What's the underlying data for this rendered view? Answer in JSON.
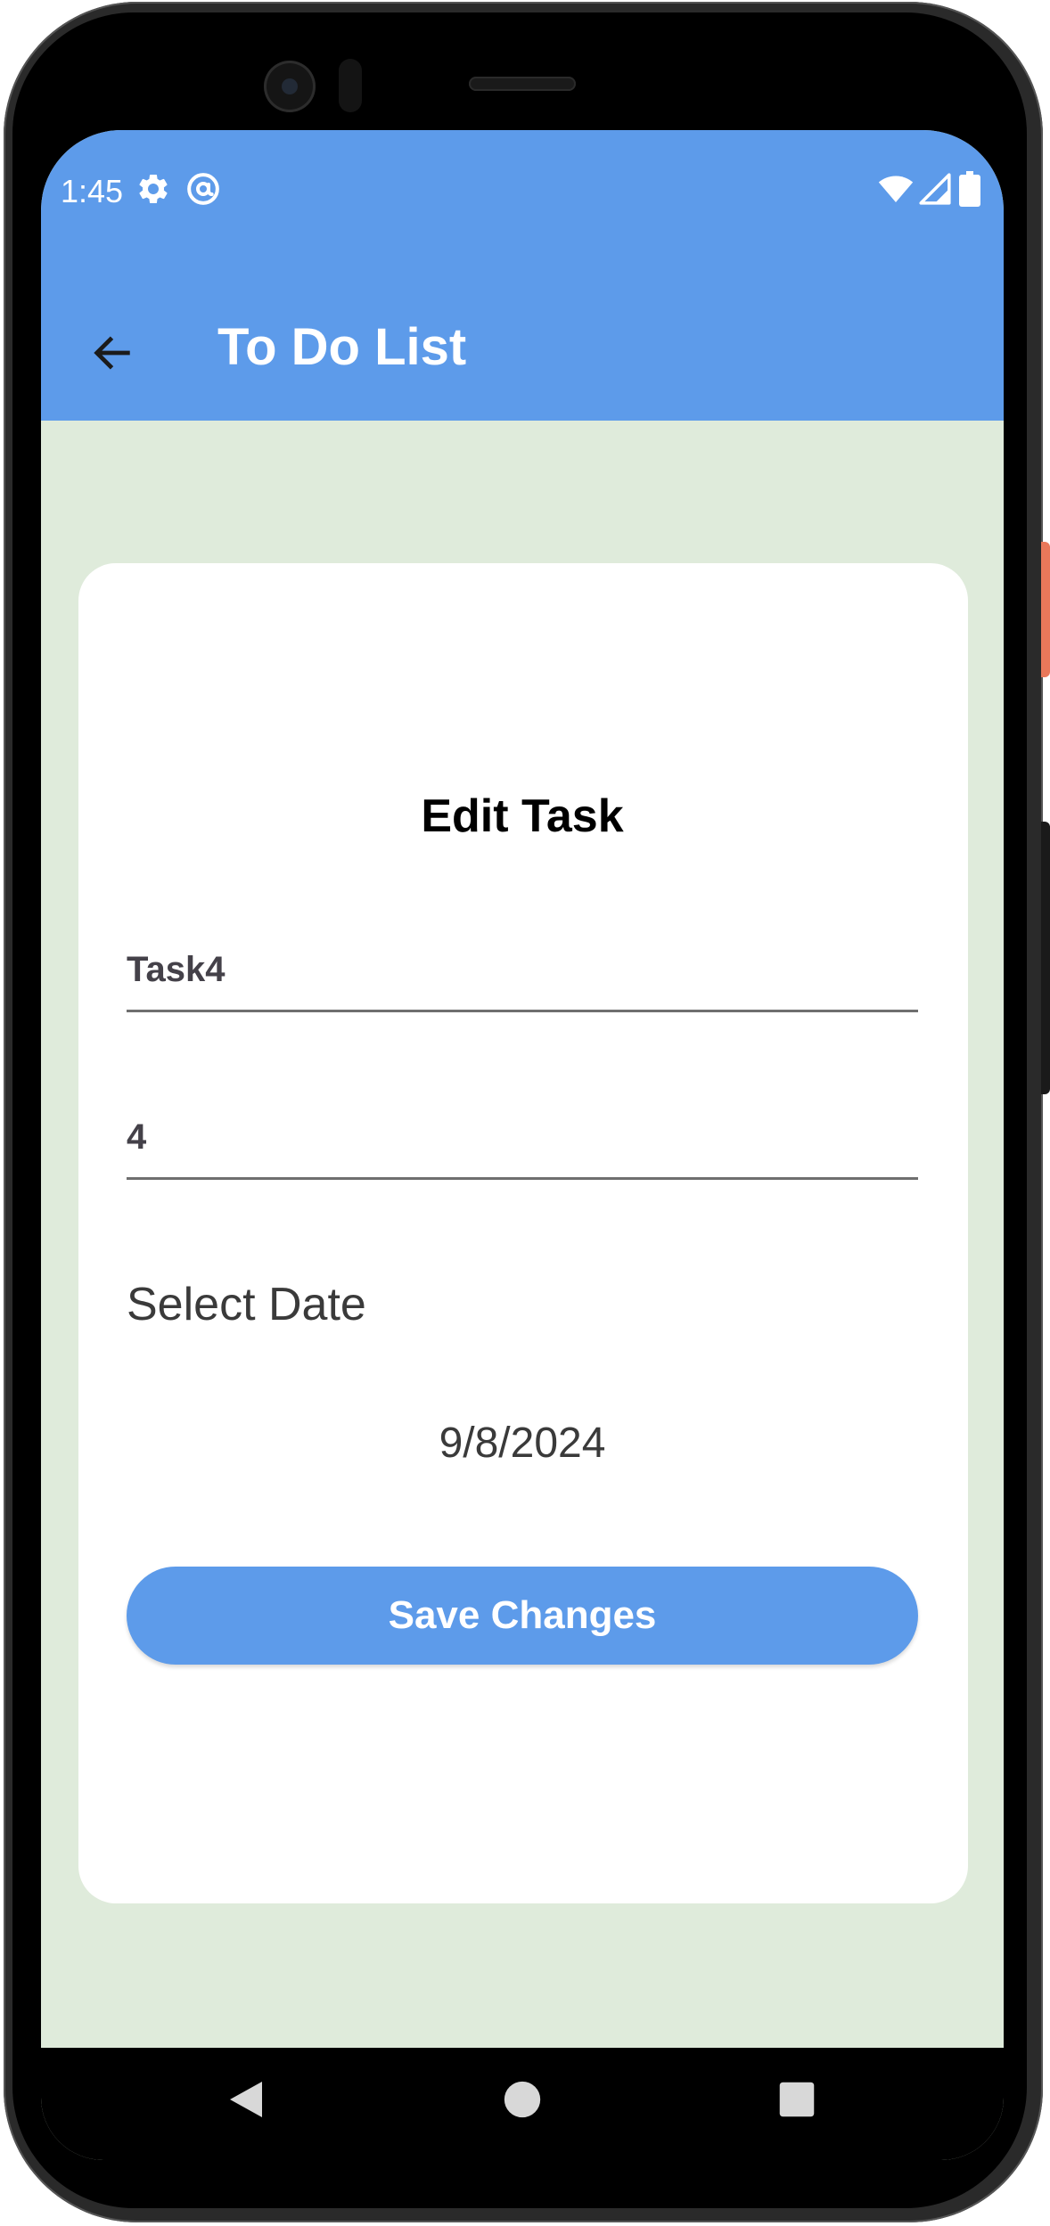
{
  "status_bar": {
    "time": "1:45",
    "left_icons": [
      "gear-icon",
      "at-sign-icon"
    ],
    "right_icons": [
      "wifi-icon",
      "cell-signal-icon",
      "battery-icon"
    ]
  },
  "app_bar": {
    "back_icon": "arrow-left-icon",
    "title": "To Do List",
    "color": "#5d9bea"
  },
  "card": {
    "title": "Edit Task",
    "task_name": {
      "value": "Task4"
    },
    "task_priority": {
      "value": "4"
    },
    "date_label": "Select Date",
    "date_value": "9/8/2024",
    "save_button": "Save Changes"
  },
  "colors": {
    "background": "#dfebdb",
    "accent": "#5d9bea",
    "card": "#ffffff"
  },
  "nav_bar": {
    "icons": [
      "back-triangle-icon",
      "home-circle-icon",
      "recents-square-icon"
    ]
  }
}
